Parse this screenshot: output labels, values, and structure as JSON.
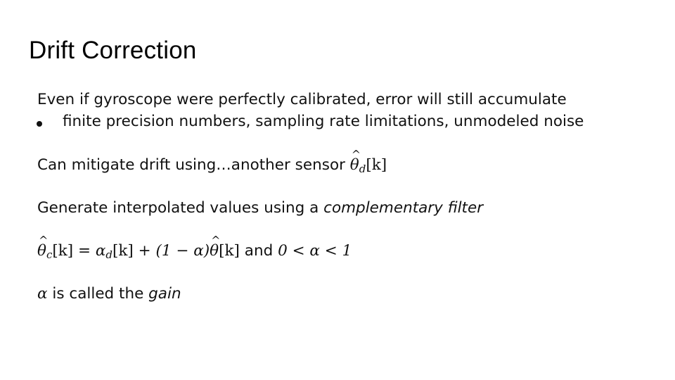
{
  "slide": {
    "title": "Drift Correction",
    "line1": "Even if gyroscope were perfectly calibrated, error will still accumulate",
    "bullet1": "finite precision numbers, sampling rate limitations, unmodeled noise",
    "line2_prefix": "Can mitigate drift using…another sensor ",
    "line2_math": {
      "symbol": "θ",
      "subscript": "d",
      "index": "[k]"
    },
    "line3_prefix": "Generate interpolated values using a ",
    "line3_italic": "complementary filter",
    "equation": {
      "lhs_symbol": "θ",
      "lhs_subscript": "c",
      "lhs_index": "[k]",
      "equals": " = ",
      "term1_symbol": "α",
      "term1_subscript": "d",
      "term1_index": "[k]",
      "plus": " + (1 − ",
      "alpha": "α",
      "close": ")",
      "term2_symbol": "θ",
      "term2_index": "[k]",
      "and": " and ",
      "constraint": "0 < α < 1"
    },
    "line5_alpha": "α",
    "line5_text": " is called the ",
    "line5_italic": "gain"
  }
}
